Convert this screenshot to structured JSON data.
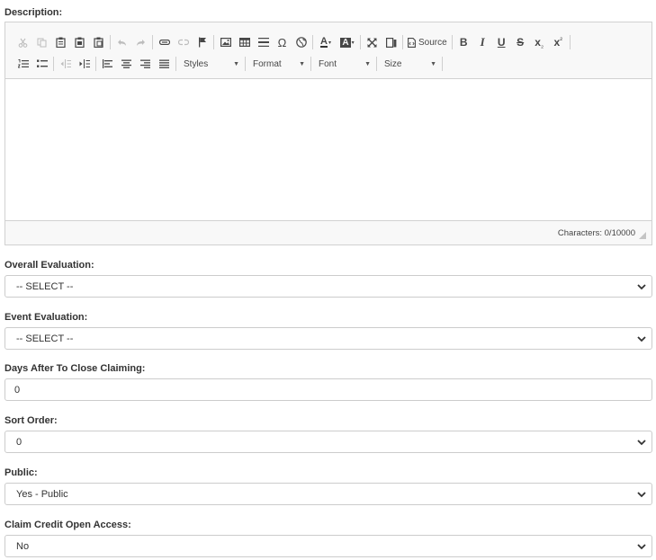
{
  "description": {
    "label": "Description:",
    "editor": {
      "toolbar_row1": [
        {
          "icon": "cut-icon",
          "enabled": false
        },
        {
          "icon": "copy-icon",
          "enabled": false
        },
        {
          "icon": "paste-icon",
          "enabled": true
        },
        {
          "icon": "paste-text-icon",
          "enabled": true
        },
        {
          "icon": "paste-word-icon",
          "enabled": true
        },
        {
          "icon": "undo-icon",
          "enabled": false
        },
        {
          "icon": "redo-icon",
          "enabled": false
        },
        {
          "icon": "link-icon",
          "enabled": true
        },
        {
          "icon": "unlink-icon",
          "enabled": false
        },
        {
          "icon": "anchor-flag-icon",
          "enabled": true
        },
        {
          "icon": "image-icon",
          "enabled": true
        },
        {
          "icon": "table-icon",
          "enabled": true
        },
        {
          "icon": "horizontal-line-icon",
          "enabled": true
        },
        {
          "icon": "special-char-icon",
          "enabled": true
        },
        {
          "icon": "iframe-globe-icon",
          "enabled": true
        },
        {
          "icon": "text-color-icon",
          "enabled": true
        },
        {
          "icon": "background-color-icon",
          "enabled": true
        },
        {
          "icon": "maximize-icon",
          "enabled": true
        },
        {
          "icon": "show-blocks-icon",
          "enabled": true
        },
        {
          "icon": "source-icon",
          "enabled": true
        },
        {
          "icon": "bold-icon",
          "enabled": true
        },
        {
          "icon": "italic-icon",
          "enabled": true
        },
        {
          "icon": "underline-icon",
          "enabled": true
        },
        {
          "icon": "strikethrough-icon",
          "enabled": true
        },
        {
          "icon": "subscript-icon",
          "enabled": true
        },
        {
          "icon": "superscript-icon",
          "enabled": true
        }
      ],
      "source_label": "Source",
      "glyphs": {
        "special_char": "Ω",
        "bold": "B",
        "italic": "I",
        "underline": "U",
        "strike": "S",
        "sub": "x",
        "sub_mark": "₂",
        "sup": "x",
        "sup_mark": "²",
        "text_color": "A",
        "bg_color": "A"
      },
      "combos": {
        "styles": "Styles",
        "format": "Format",
        "font": "Font",
        "size": "Size"
      },
      "content": "",
      "char_counter": "Characters: 0/10000"
    }
  },
  "overall_evaluation": {
    "label": "Overall Evaluation:",
    "value": "-- SELECT --"
  },
  "event_evaluation": {
    "label": "Event Evaluation:",
    "value": "-- SELECT --"
  },
  "days_after_close": {
    "label": "Days After To Close Claiming:",
    "value": "0"
  },
  "sort_order": {
    "label": "Sort Order:",
    "value": "0"
  },
  "public": {
    "label": "Public:",
    "value": "Yes - Public"
  },
  "claim_credit_open_access": {
    "label": "Claim Credit Open Access:",
    "value": "No"
  },
  "colors": {
    "border": "#cccccc",
    "toolbar_bg": "#f8f8f8",
    "text": "#333333",
    "disabled_icon": "#bdbdbd"
  }
}
